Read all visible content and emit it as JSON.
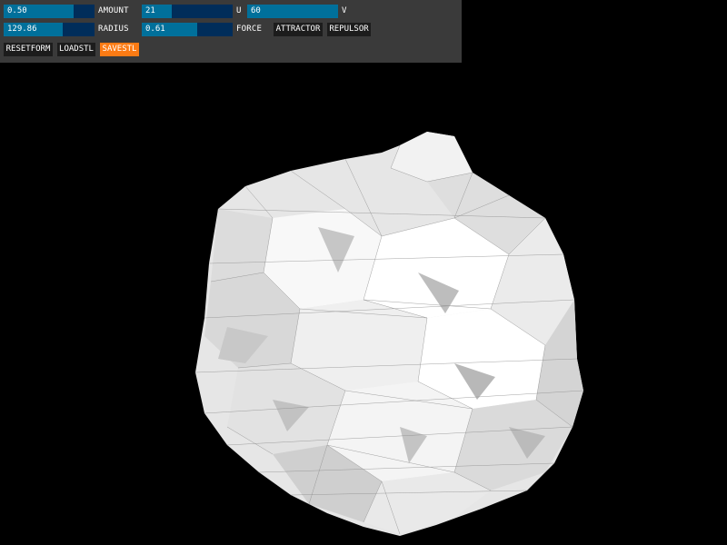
{
  "controls": {
    "amount": {
      "value": "0.50",
      "label": "AMOUNT",
      "fraction": 0.77
    },
    "radius": {
      "value": "129.86",
      "label": "RADIUS",
      "fraction": 0.65
    },
    "u": {
      "value": "21",
      "label": "U",
      "fraction": 0.33
    },
    "force": {
      "value": "0.61",
      "label": "FORCE",
      "fraction": 0.61
    },
    "v": {
      "value": "60",
      "label": "V",
      "fraction": 1.0
    }
  },
  "buttons": {
    "attractor": "ATTRACTOR",
    "repulsor": "REPULSOR",
    "resetform": "RESETFORM",
    "loadstl": "LOADSTL",
    "savestl": "SAVESTL"
  },
  "colors": {
    "panel": "#3a3a3a",
    "slider_track": "#002d5a",
    "slider_fill": "#00709b",
    "button": "#1c1c1c",
    "button_active": "#fb7b14",
    "background": "#000000"
  }
}
